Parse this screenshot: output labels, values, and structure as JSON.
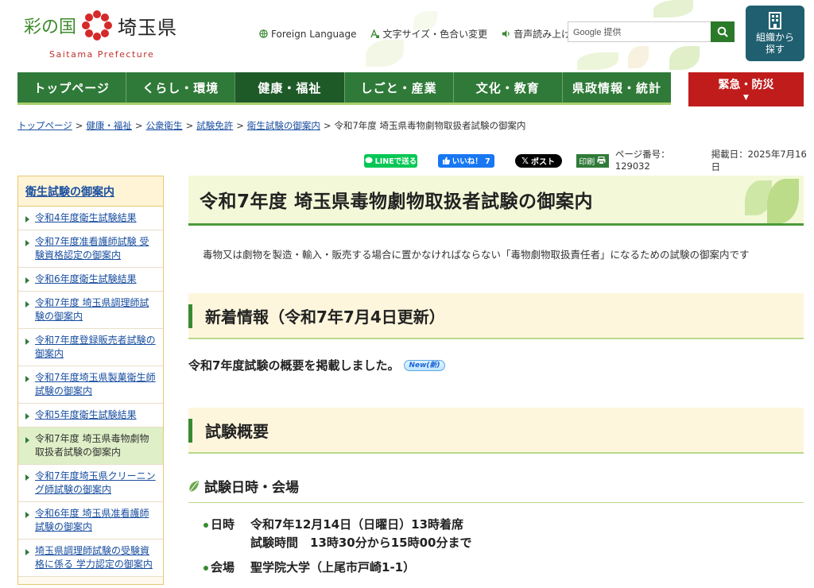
{
  "header": {
    "logo_kuni": "彩の国",
    "logo_name": "埼玉県",
    "logo_sub": "Saitama Prefecture",
    "links": [
      {
        "label": "Foreign Language",
        "icon": "globe-icon"
      },
      {
        "label": "文字サイズ・色合い変更",
        "icon": "text-size-icon"
      },
      {
        "label": "音声読み上げ",
        "icon": "speaker-icon"
      }
    ],
    "search_placeholder": "Google 提供",
    "org_button": "組織から\n探す"
  },
  "nav": {
    "items": [
      "トップページ",
      "くらし・環境",
      "健康・福祉",
      "しごと・産業",
      "文化・教育",
      "県政情報・統計"
    ],
    "active_index": 2,
    "emergency": "緊急・防災"
  },
  "breadcrumb": {
    "links": [
      "トップページ",
      "健康・福祉",
      "公衆衛生",
      "試験免許",
      "衛生試験の御案内"
    ],
    "current": "令和7年度 埼玉県毒物劇物取扱者試験の御案内"
  },
  "share": {
    "line": "LINEで送る",
    "like": "いいね！ 7",
    "x": "ポスト",
    "print": "印刷",
    "page_number": "ページ番号：129032",
    "posted": "掲載日：2025年7月16日"
  },
  "sidebar": {
    "title": "衛生試験の御案内",
    "items": [
      "令和4年度衛生試験結果",
      "令和7年度准看護師試験 受験資格認定の御案内",
      "令和6年度衛生試験結果",
      "令和7年度 埼玉県調理師試験の御案内",
      "令和7年度登録販売者試験の御案内",
      "令和7年度埼玉県製菓衛生師試験の御案内",
      "令和5年度衛生試験結果",
      "令和7年度 埼玉県毒物劇物取扱者試験の御案内",
      "令和7年度埼玉県クリーニング師試験の御案内",
      "令和6年度 埼玉県准看護師試験の御案内",
      "埼玉県調理師試験の受験資格に係る 学力認定の御案内"
    ],
    "current_index": 7
  },
  "main": {
    "title": "令和7年度 埼玉県毒物劇物取扱者試験の御案内",
    "lead": "毒物又は劇物を製造・輸入・販売する場合に置かなければならない「毒物劇物取扱責任者」になるための試験の御案内です",
    "news_heading": "新着情報（令和7年7月4日更新）",
    "news_text": "令和7年度試験の概要を掲載しました。",
    "news_badge": "New(新)",
    "overview_heading": "試験概要",
    "datetime_heading": "試験日時・会場",
    "details": {
      "date_label": "日時",
      "date_value": "令和7年12月14日（日曜日）13時着席",
      "time_value": "試験時間　13時30分から15時00分まで",
      "venue_label": "会場",
      "venue_value": "聖学院大学（上尾市戸崎1-1）"
    }
  },
  "colors": {
    "nav_green": "#2f7a38",
    "nav_active": "#1e5a28",
    "emergency_red": "#c01c1c",
    "link_blue": "#1a4fa0",
    "org_button": "#1f5f6f"
  }
}
